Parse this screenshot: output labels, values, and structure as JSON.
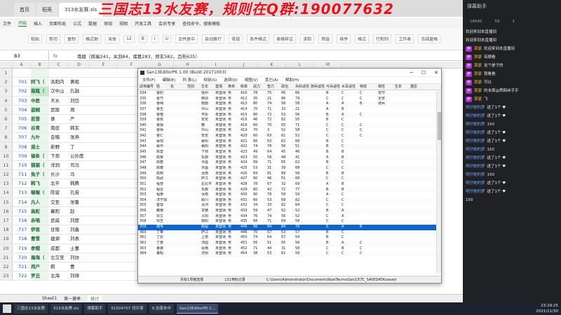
{
  "stream_title": "三国志13水友赛，规则在Q群:190077632",
  "tabs": [
    "首页",
    "稻壳",
    "313水友赛.xls"
  ],
  "menu": [
    "文件",
    "开始",
    "插入",
    "页面布局",
    "公式",
    "数据",
    "审阅",
    "视图",
    "开发工具",
    "会员专享",
    "查找命令、搜索模板"
  ],
  "ribbon": [
    "粘贴",
    "剪切",
    "复制",
    "格式刷",
    "宋体",
    "12",
    "B",
    "I",
    "U",
    "合并居中",
    "自动换行",
    "常规",
    "条件格式",
    "表格样式",
    "求和",
    "筛选",
    "排序",
    "格式",
    "行和列",
    "工作表",
    "冻结窗格"
  ],
  "formula": {
    "cell": "B3",
    "fx": "fx",
    "text": "南瓶（周瑜241，关羽84，诸葛283，郑玄582，吕布635）"
  },
  "columns": [
    "A",
    "B",
    "C",
    "D",
    "E",
    "F",
    "G",
    "H",
    "I",
    "J",
    "K",
    "L",
    "M"
  ],
  "rows": [
    {
      "n": "1",
      "a": "",
      "b": "",
      "c": "",
      "d": ""
    },
    {
      "n": "2",
      "a": "701",
      "b": "阿飞（",
      "c": "洛阳内",
      "d": "黄祖"
    },
    {
      "n": "3",
      "a": "702",
      "b": "南瓶（",
      "c": "汉中山",
      "d": "孔融"
    },
    {
      "n": "4",
      "a": "703",
      "b": "中医",
      "c": "天水",
      "d": "刘岱"
    },
    {
      "n": "5",
      "a": "704",
      "b": "盗贼",
      "c": "武陵",
      "d": "周"
    },
    {
      "n": "6",
      "a": "705",
      "b": "若雪",
      "c": "谯",
      "d": "严"
    },
    {
      "n": "7",
      "a": "706",
      "b": "谷青",
      "c": "南皮",
      "d": "韩玄"
    },
    {
      "n": "8",
      "a": "707",
      "b": "九叶",
      "c": "会稽",
      "d": "张燕"
    },
    {
      "n": "9",
      "a": "708",
      "b": "道士",
      "c": "新野",
      "d": "丁"
    },
    {
      "n": "10",
      "a": "709",
      "b": "锡条（",
      "c": "下邳",
      "d": "公孙度"
    },
    {
      "n": "11",
      "a": "710",
      "b": "猫猫（",
      "c": "洋洞",
      "d": "司马"
    },
    {
      "n": "12",
      "a": "711",
      "b": "兔子（",
      "c": "长沙",
      "d": "马"
    },
    {
      "n": "13",
      "a": "712",
      "b": "韩飞",
      "c": "北平",
      "d": "韩腾"
    },
    {
      "n": "14",
      "a": "713",
      "b": "喔喔（",
      "c": "陈留",
      "d": "孔宙"
    },
    {
      "n": "15",
      "a": "714",
      "b": "凡人",
      "c": "交至",
      "d": "张鲁"
    },
    {
      "n": "16",
      "a": "715",
      "b": "高舵",
      "c": "襄阳",
      "d": "赵"
    },
    {
      "n": "17",
      "a": "716",
      "b": "赤喵",
      "c": "武威",
      "d": "刘度"
    },
    {
      "n": "18",
      "a": "717",
      "b": "伊恩",
      "c": "甘陵",
      "d": "刘备"
    },
    {
      "n": "19",
      "a": "718",
      "b": "曹雪",
      "c": "建邺",
      "d": "刘表"
    },
    {
      "n": "20",
      "a": "719",
      "b": "孝帽",
      "c": "成都",
      "d": "土董"
    },
    {
      "n": "21",
      "a": "720",
      "b": "瀚海（",
      "c": "北交至",
      "d": "刘协"
    },
    {
      "n": "22",
      "a": "721",
      "b": "用户",
      "c": "蓟",
      "d": "曹"
    },
    {
      "n": "23",
      "a": "722",
      "b": "罗丑",
      "c": "北海",
      "d": "刘璋"
    }
  ],
  "sheet_tabs": [
    "Sheet1",
    "第一赛季",
    "统计"
  ],
  "editor": {
    "title": "San13EditorPK 1.00 (Build 20171003)",
    "menu": [
      "文件(F)",
      "编辑(E)",
      "列 表(L)",
      "特别(S)",
      "选项(O)",
      "视图(V)",
      "其它(A)",
      "帮助(H)"
    ],
    "headers": [
      "武将编号",
      "姓",
      "名",
      "性别",
      "生年",
      "登场",
      "寿命",
      "统率",
      "武力",
      "智力",
      "政治",
      "兵科适性",
      "骑兵适性",
      "弓兵适性",
      "水军适性",
      "特技",
      "相性",
      "生年",
      "重臣"
    ],
    "rows": [
      [
        "334",
        "曹豹",
        "",
        "",
        "徐州",
        "未登场",
        "男",
        "410",
        "78",
        "75",
        "45",
        "66",
        "",
        "B",
        "C",
        "C",
        "攻守",
        ""
      ],
      [
        "335",
        "曹节",
        "",
        "",
        "西凉",
        "未登场",
        "男",
        "412",
        "35",
        "21",
        "86",
        "79",
        "",
        "C",
        "C",
        "C",
        "长安",
        ""
      ],
      [
        "336",
        "曹纯",
        "",
        "",
        "南郡",
        "未登场",
        "男",
        "413",
        "80",
        "74",
        "56",
        "58",
        "",
        "A",
        "A",
        "B",
        "骑兵",
        ""
      ],
      [
        "337",
        "曹丕",
        "",
        "",
        "中山",
        "未登场",
        "男",
        "414",
        "70",
        "71",
        "32",
        "21",
        "",
        "A",
        "B",
        "",
        "",
        ""
      ],
      [
        "338",
        "曹植",
        "",
        "",
        "平原",
        "未登场",
        "男",
        "415",
        "80",
        "72",
        "53",
        "56",
        "",
        "B",
        "A",
        "C",
        "",
        ""
      ],
      [
        "339",
        "曹宪",
        "",
        "",
        "安定",
        "未登场",
        "男",
        "416",
        "46",
        "72",
        "82",
        "55",
        "",
        "B",
        "C",
        "",
        "",
        ""
      ],
      [
        "340",
        "曹操",
        "",
        "",
        "籍",
        "未登场",
        "男",
        "418",
        "60",
        "70",
        "65",
        "71",
        "",
        "C",
        "C",
        "C",
        "",
        ""
      ],
      [
        "341",
        "曹休",
        "",
        "",
        "中山",
        "未登场",
        "男",
        "419",
        "70",
        "3",
        "52",
        "58",
        "",
        "C",
        "C",
        "C",
        "",
        ""
      ],
      [
        "342",
        "曹仁",
        "",
        "",
        "安定",
        "未登场",
        "男",
        "420",
        "60",
        "63",
        "61",
        "52",
        "",
        "C",
        "C",
        "C",
        "",
        ""
      ],
      [
        "343",
        "蔡瑁",
        "",
        "",
        "襄阳",
        "未登场",
        "男",
        "421",
        "66",
        "63",
        "62",
        "68",
        "",
        "B",
        "C",
        "",
        "",
        ""
      ],
      [
        "344",
        "蔡中",
        "",
        "",
        "襄阳",
        "未登场",
        "男",
        "422",
        "74",
        "78",
        "56",
        "51",
        "",
        "B",
        "C",
        "",
        "",
        ""
      ],
      [
        "345",
        "陈登",
        "",
        "",
        "下邳",
        "未登场",
        "男",
        "423",
        "49",
        "64",
        "45",
        "46",
        "",
        "B",
        "B",
        "",
        "",
        ""
      ],
      [
        "346",
        "陈宫",
        "",
        "",
        "东郡",
        "未登场",
        "男",
        "423",
        "50",
        "59",
        "49",
        "41",
        "",
        "A",
        "B",
        "",
        "",
        ""
      ],
      [
        "347",
        "陈群",
        "",
        "",
        "许昌",
        "未登场",
        "男",
        "424",
        "89",
        "71",
        "65",
        "62",
        "",
        "B",
        "C",
        "",
        "",
        ""
      ],
      [
        "348",
        "陈泰",
        "",
        "",
        "许昌",
        "未登场",
        "男",
        "425",
        "53",
        "31",
        "39",
        "68",
        "",
        "C",
        "C",
        "",
        "",
        ""
      ],
      [
        "349",
        "陈到",
        "",
        "",
        "汝南",
        "未登场",
        "男",
        "426",
        "84",
        "81",
        "89",
        "58",
        "",
        "B",
        "B",
        "",
        "",
        ""
      ],
      [
        "350",
        "陈武",
        "",
        "",
        "庐江",
        "未登场",
        "男",
        "427",
        "60",
        "46",
        "51",
        "68",
        "",
        "C",
        "C",
        "",
        "",
        ""
      ],
      [
        "351",
        "程普",
        "",
        "",
        "右北平",
        "未登场",
        "男",
        "428",
        "78",
        "67",
        "32",
        "69",
        "",
        "A",
        "B",
        "",
        "",
        ""
      ],
      [
        "352",
        "程昱",
        "",
        "",
        "东郡",
        "未登场",
        "男",
        "429",
        "60",
        "42",
        "72",
        "77",
        "",
        "B",
        "B",
        "",
        "",
        ""
      ],
      [
        "353",
        "程秉",
        "",
        "",
        "汝南",
        "未登场",
        "男",
        "430",
        "90",
        "78",
        "58",
        "59",
        "",
        "A",
        "C",
        "",
        "",
        ""
      ],
      [
        "354",
        "淳于琼",
        "",
        "",
        "颍川",
        "未登场",
        "男",
        "431",
        "66",
        "53",
        "69",
        "82",
        "",
        "C",
        "C",
        "",
        "",
        ""
      ],
      [
        "355",
        "崔琰",
        "",
        "",
        "清河",
        "未登场",
        "男",
        "432",
        "34",
        "33",
        "82",
        "64",
        "",
        "C",
        "C",
        "",
        "",
        ""
      ],
      [
        "356",
        "戴陵",
        "",
        "",
        "甘陵",
        "未登场",
        "男",
        "433",
        "59",
        "47",
        "62",
        "52",
        "",
        "B",
        "A",
        "",
        "",
        ""
      ],
      [
        "357",
        "邓艾",
        "",
        "",
        "义阳",
        "未登场",
        "男",
        "434",
        "76",
        "74",
        "56",
        "52",
        "",
        "C",
        "A",
        "",
        "",
        ""
      ],
      [
        "358",
        "邓芝",
        "",
        "",
        "南阳",
        "未登场",
        "男",
        "435",
        "68",
        "71",
        "69",
        "58",
        "",
        "C",
        "C",
        "",
        "",
        ""
      ],
      [
        "359",
        "典韦",
        "",
        "",
        "陈留",
        "未登场",
        "男",
        "445",
        "96",
        "94",
        "84",
        "70",
        "",
        "S",
        "A",
        "B",
        "",
        ""
      ],
      [
        "360",
        "丁奉",
        "",
        "",
        "庐江",
        "未登场",
        "男",
        "446",
        "70",
        "57",
        "53",
        "57",
        "",
        "B",
        "C",
        "",
        "",
        ""
      ],
      [
        "361",
        "丁原",
        "",
        "",
        "上党",
        "未登场",
        "男",
        "450",
        "74",
        "64",
        "67",
        "54",
        "",
        "B",
        "C",
        "",
        "",
        ""
      ],
      [
        "362",
        "丁斐",
        "",
        "",
        "沛国",
        "未登场",
        "男",
        "451",
        "56",
        "51",
        "65",
        "56",
        "",
        "B",
        "A",
        "C",
        "",
        ""
      ],
      [
        "363",
        "董袭",
        "",
        "",
        "会稽",
        "未登场",
        "男",
        "452",
        "71",
        "44",
        "31",
        "58",
        "",
        "C",
        "B",
        "C",
        "",
        ""
      ],
      [
        "364",
        "董昭",
        "",
        "",
        "济阴",
        "未登场",
        "男",
        "454",
        "38",
        "53",
        "61",
        "59",
        "",
        "C",
        "C",
        "C",
        "",
        ""
      ]
    ],
    "selected_index": 25,
    "status": [
      "共有1项被选择",
      "131筛检记录",
      "C:\\Users\\Administrator\\Documents\\KoeiTecmo\\San13\\TC_SAVEDATA\\saved"
    ]
  },
  "side": {
    "title": "弹幕助手",
    "stats": [
      "18040",
      "59",
      "1"
    ],
    "messages": [
      {
        "badge": "",
        "user": "",
        "text": "欢迎来到本直播间"
      },
      {
        "badge": "",
        "user": "",
        "text": "欢迎来到本直播间"
      },
      {
        "badge": "伊",
        "user": "萧瑟",
        "text": "欢迎来到本直播间"
      },
      {
        "badge": "伊",
        "user": "萧瑟",
        "text": "有眼看"
      },
      {
        "badge": "伊",
        "user": "萧瑟",
        "text": "这个是子的"
      },
      {
        "badge": "伊",
        "user": "萧瑟",
        "text": "我看看"
      },
      {
        "badge": "伊",
        "user": "萧瑟",
        "text": "可以"
      },
      {
        "badge": "伊",
        "user": "萧瑟",
        "text": "的本周@秀韩丝乎乎"
      },
      {
        "badge": "伊",
        "user": "萧瑟",
        "text": "飞"
      },
      {
        "badge": "",
        "user": "明仔她的梦",
        "text": "送了1个 ♥"
      },
      {
        "badge": "",
        "user": "明仔她的梦",
        "text": "送了1个 ♥"
      },
      {
        "badge": "",
        "user": "明仔她的梦",
        "text": "150"
      },
      {
        "badge": "",
        "user": "明仔她的梦",
        "text": "送了1个 ♥"
      },
      {
        "badge": "",
        "user": "明仔她的梦",
        "text": "送了1个 ♥"
      },
      {
        "badge": "",
        "user": "明仔她的梦",
        "text": "150"
      },
      {
        "badge": "",
        "user": "明仔她的梦",
        "text": "送了1个 ♥"
      },
      {
        "badge": "",
        "user": "明仔她的梦",
        "text": "送了1个 ♥"
      },
      {
        "badge": "",
        "user": "明仔她的梦",
        "text": "150"
      },
      {
        "badge": "",
        "user": "明仔她的梦",
        "text": "送了1个 ♥"
      },
      {
        "badge": "",
        "user": "明仔她的梦",
        "text": "送了1个 ♥"
      },
      {
        "badge": "",
        "user": "",
        "text": "150"
      }
    ]
  },
  "taskbar": [
    "三国志13水友赛",
    "313水友赛.xls",
    "弹幕助手",
    "51504707 伐乐客",
    "9.吉版本中",
    "San13EditorPK 1..."
  ],
  "clock": {
    "time": "23:29:25",
    "date": "2021/11/30"
  }
}
